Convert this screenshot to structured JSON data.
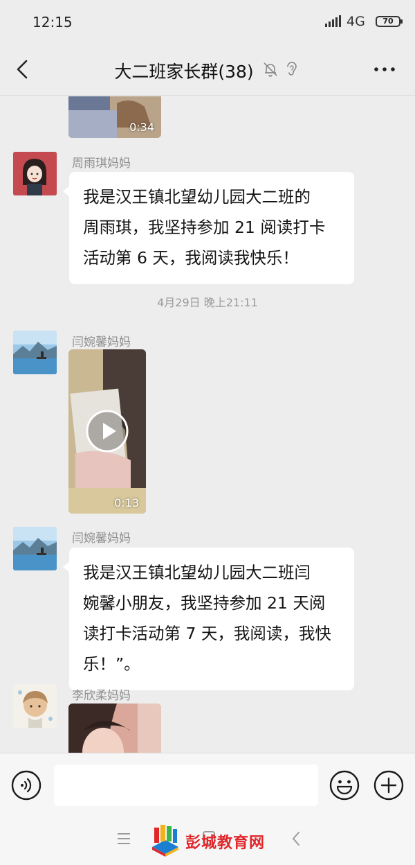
{
  "status_bar": {
    "time": "12:15",
    "network": "4G",
    "battery": "70"
  },
  "header": {
    "title": "大二班家长群(38)"
  },
  "messages": [
    {
      "type": "video",
      "duration": "0:34"
    },
    {
      "type": "text",
      "sender": "周雨琪妈妈",
      "lines": [
        "我是汉王镇北望幼儿园大二班的",
        "周雨琪，我坚持参加 21 阅读打卡",
        "活动第 6 天，我阅读我快乐！"
      ]
    },
    {
      "type": "timestamp",
      "text": "4月29日 晚上21:11"
    },
    {
      "type": "video",
      "sender": "闫婉馨妈妈",
      "duration": "0:13"
    },
    {
      "type": "text",
      "sender": "闫婉馨妈妈",
      "lines": [
        "我是汉王镇北望幼儿园大二班闫",
        "婉馨小朋友，我坚持参加 21 天阅",
        "读打卡活动第 7 天，我阅读，我快",
        "乐！”。"
      ]
    },
    {
      "type": "image",
      "sender": "李欣柔妈妈"
    }
  ],
  "input_bar": {
    "placeholder": ""
  },
  "watermark": {
    "text": "彭城教育网"
  },
  "icons": {
    "back": "chevron-left-icon",
    "mute": "bell-off-icon",
    "ear": "ear-icon",
    "more": "more-icon",
    "voice": "voice-icon",
    "emoji": "emoji-icon",
    "add": "plus-icon"
  },
  "colors": {
    "background": "#ededed",
    "bubble": "#ffffff",
    "watermark": "#e0262a"
  }
}
